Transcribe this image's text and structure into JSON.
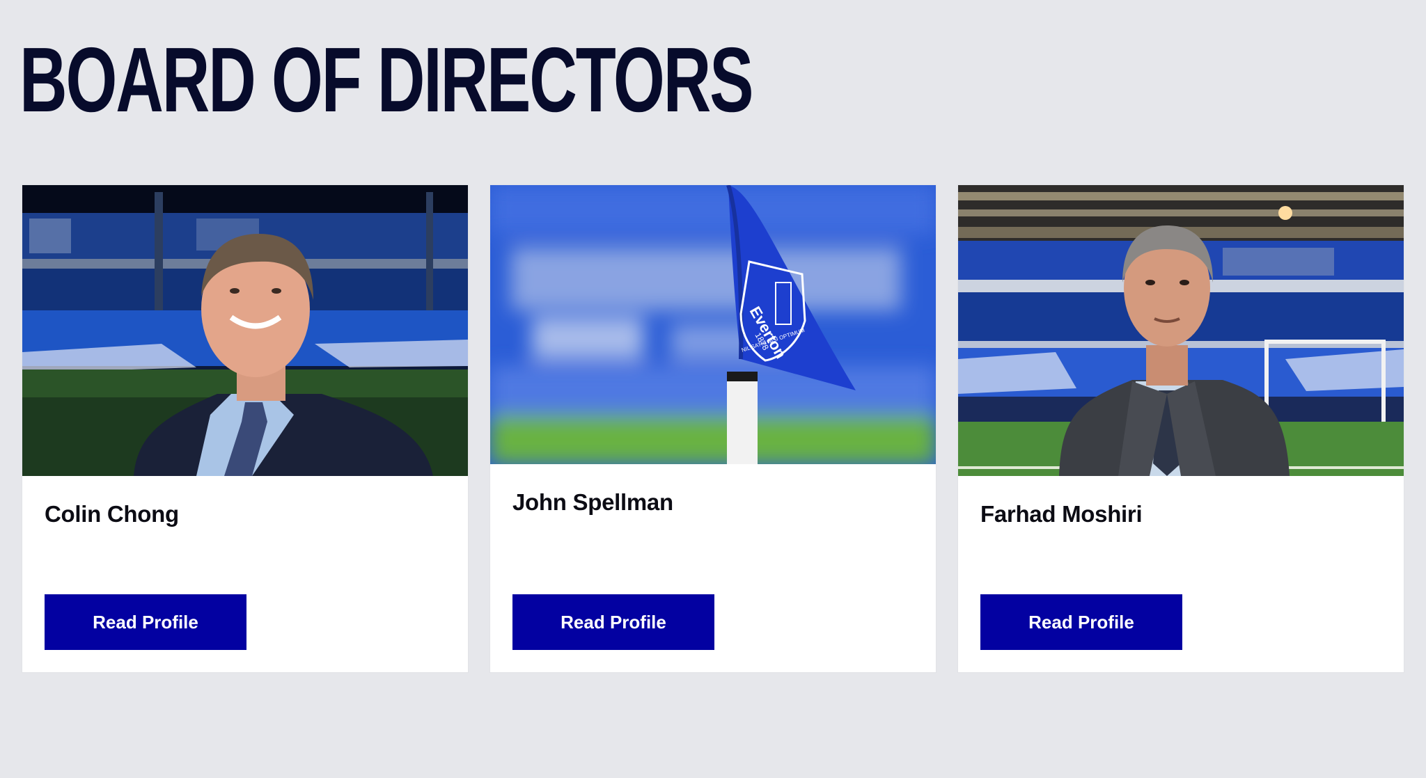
{
  "page": {
    "title": "BOARD OF DIRECTORS",
    "background": "#e6e7eb"
  },
  "brand": {
    "navy": "#070b2b",
    "button_blue": "#0301a1",
    "card_background": "#ffffff"
  },
  "directors": [
    {
      "name": "Colin Chong",
      "button_label": "Read Profile",
      "photo": "director-portrait-stadium"
    },
    {
      "name": "John Spellman",
      "button_label": "Read Profile",
      "photo": "everton-corner-flag",
      "flag_text": "Everton",
      "flag_year": "1878",
      "flag_motto": "NIL SATIS NISI OPTIMUM"
    },
    {
      "name": "Farhad Moshiri",
      "button_label": "Read Profile",
      "photo": "director-portrait-stadium"
    }
  ]
}
